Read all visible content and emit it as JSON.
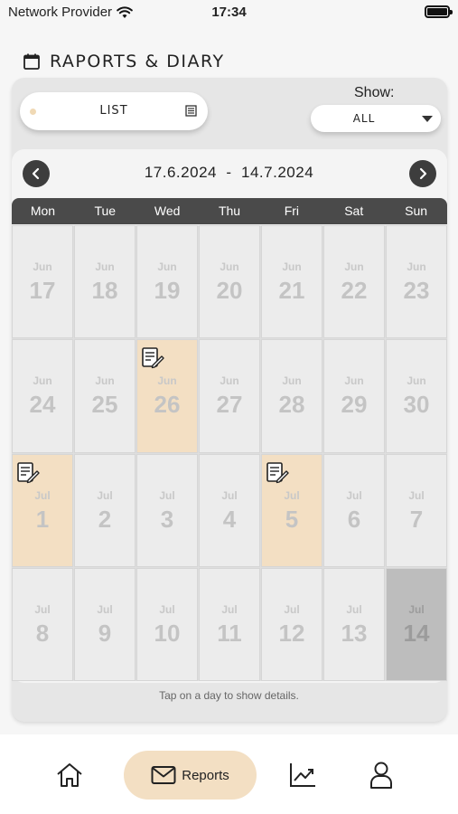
{
  "status_bar": {
    "carrier": "Network Provider",
    "time": "17:34"
  },
  "header": {
    "title": "RAPORTS & DIARY",
    "icon": "calendar-icon"
  },
  "view_toggle": {
    "label": "LIST",
    "icon": "list-icon"
  },
  "filter": {
    "label": "Show:",
    "value": "ALL"
  },
  "calendar": {
    "range": "17.6.2024  -  14.7.2024",
    "weekdays": [
      "Mon",
      "Tue",
      "Wed",
      "Thu",
      "Fri",
      "Sat",
      "Sun"
    ],
    "days": [
      {
        "month": "Jun",
        "day": "17"
      },
      {
        "month": "Jun",
        "day": "18"
      },
      {
        "month": "Jun",
        "day": "19"
      },
      {
        "month": "Jun",
        "day": "20"
      },
      {
        "month": "Jun",
        "day": "21"
      },
      {
        "month": "Jun",
        "day": "22"
      },
      {
        "month": "Jun",
        "day": "23"
      },
      {
        "month": "Jun",
        "day": "24"
      },
      {
        "month": "Jun",
        "day": "25"
      },
      {
        "month": "Jun",
        "day": "26",
        "report": true
      },
      {
        "month": "Jun",
        "day": "27"
      },
      {
        "month": "Jun",
        "day": "28"
      },
      {
        "month": "Jun",
        "day": "29"
      },
      {
        "month": "Jun",
        "day": "30"
      },
      {
        "month": "Jul",
        "day": "1",
        "report": true
      },
      {
        "month": "Jul",
        "day": "2"
      },
      {
        "month": "Jul",
        "day": "3"
      },
      {
        "month": "Jul",
        "day": "4"
      },
      {
        "month": "Jul",
        "day": "5",
        "report": true
      },
      {
        "month": "Jul",
        "day": "6"
      },
      {
        "month": "Jul",
        "day": "7"
      },
      {
        "month": "Jul",
        "day": "8"
      },
      {
        "month": "Jul",
        "day": "9"
      },
      {
        "month": "Jul",
        "day": "10"
      },
      {
        "month": "Jul",
        "day": "11"
      },
      {
        "month": "Jul",
        "day": "12"
      },
      {
        "month": "Jul",
        "day": "13"
      },
      {
        "month": "Jul",
        "day": "14",
        "selected": true
      }
    ],
    "hint": "Tap on a day to show details."
  },
  "tabbar": {
    "items": [
      {
        "name": "home",
        "icon": "home-icon"
      },
      {
        "name": "reports",
        "label": "Reports",
        "icon": "envelope-icon",
        "active": true
      },
      {
        "name": "stats",
        "icon": "chart-icon"
      },
      {
        "name": "profile",
        "icon": "user-icon"
      }
    ]
  },
  "colors": {
    "report_day": "#f3dfc3",
    "selected_day": "#bdbdbd",
    "accent": "#f3dfc3",
    "header_bar": "#4a4a4a"
  }
}
